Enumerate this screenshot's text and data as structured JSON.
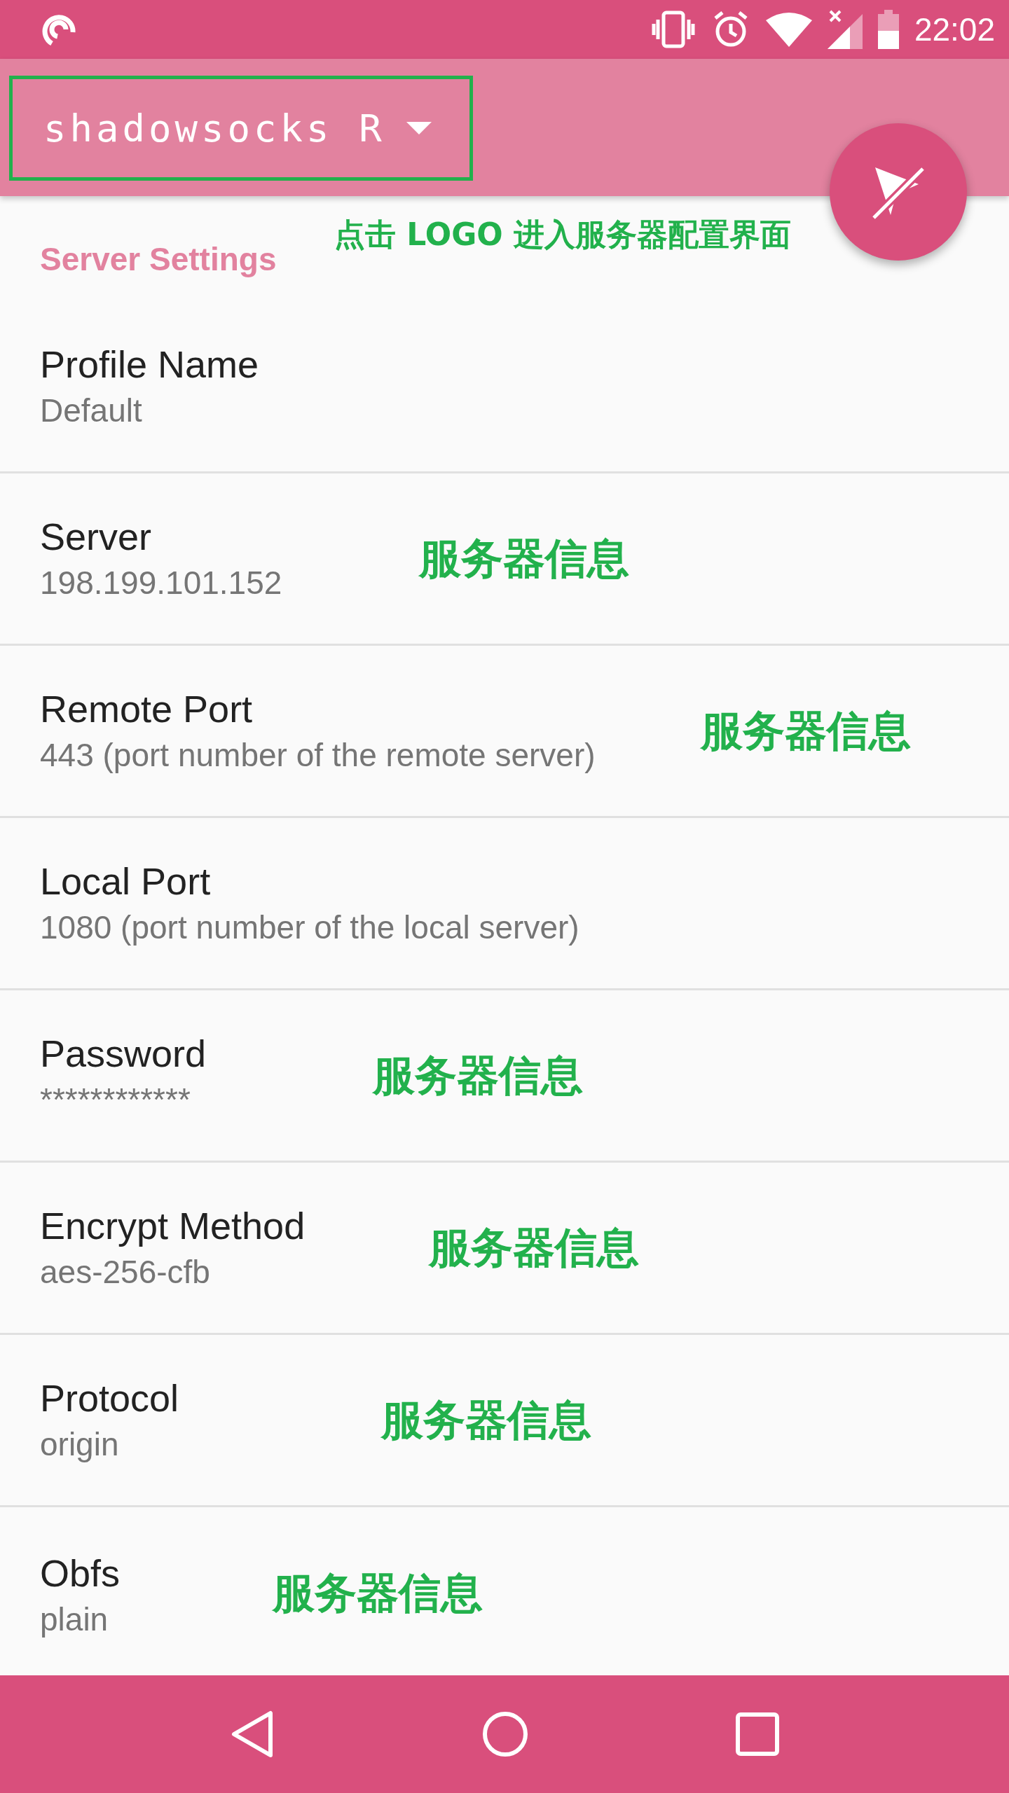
{
  "status_bar": {
    "time": "22:02"
  },
  "toolbar": {
    "title": "shadowsocks R",
    "highlighted": true
  },
  "annotation_header": "点击 LOGO 进入服务器配置界面",
  "section_title": "Server Settings",
  "settings": [
    {
      "title": "Profile Name",
      "value": "Default"
    },
    {
      "title": "Server",
      "value": "198.199.101.152",
      "annotation": "服务器信息"
    },
    {
      "title": "Remote Port",
      "value": "443 (port number of the remote server)",
      "annotation": "服务器信息"
    },
    {
      "title": "Local Port",
      "value": "1080 (port number of the local server)"
    },
    {
      "title": "Password",
      "value": "************",
      "annotation": "服务器信息"
    },
    {
      "title": "Encrypt Method",
      "value": "aes-256-cfb",
      "annotation": "服务器信息"
    },
    {
      "title": "Protocol",
      "value": "origin",
      "annotation": "服务器信息"
    },
    {
      "title": "Obfs",
      "value": "plain",
      "annotation": "服务器信息"
    }
  ]
}
